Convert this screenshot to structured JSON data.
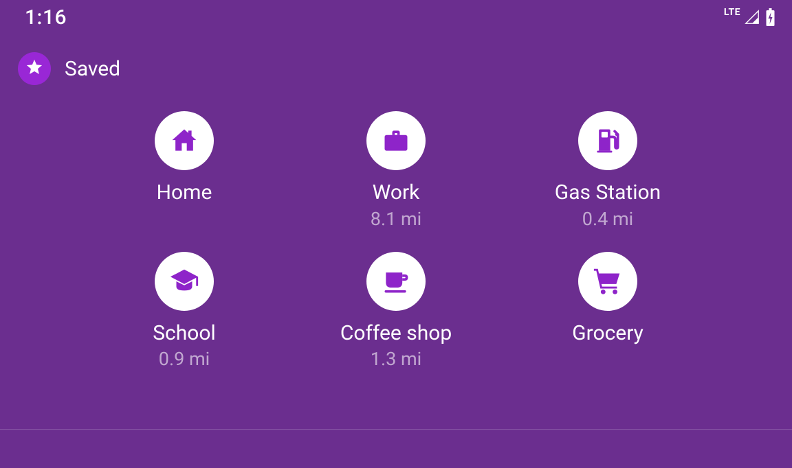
{
  "status": {
    "time": "1:16",
    "network_label": "LTE"
  },
  "header": {
    "title": "Saved"
  },
  "colors": {
    "background": "#6b2e8f",
    "accent": "#9927d6",
    "icon_fg": "#8e24c9"
  },
  "tiles": [
    {
      "id": "home",
      "label": "Home",
      "sub": "",
      "icon": "home"
    },
    {
      "id": "work",
      "label": "Work",
      "sub": "8.1 mi",
      "icon": "briefcase"
    },
    {
      "id": "gas",
      "label": "Gas Station",
      "sub": "0.4 mi",
      "icon": "gas-pump"
    },
    {
      "id": "school",
      "label": "School",
      "sub": "0.9 mi",
      "icon": "graduation-cap"
    },
    {
      "id": "coffee",
      "label": "Coffee shop",
      "sub": "1.3 mi",
      "icon": "coffee"
    },
    {
      "id": "grocery",
      "label": "Grocery",
      "sub": "",
      "icon": "shopping-cart"
    }
  ]
}
